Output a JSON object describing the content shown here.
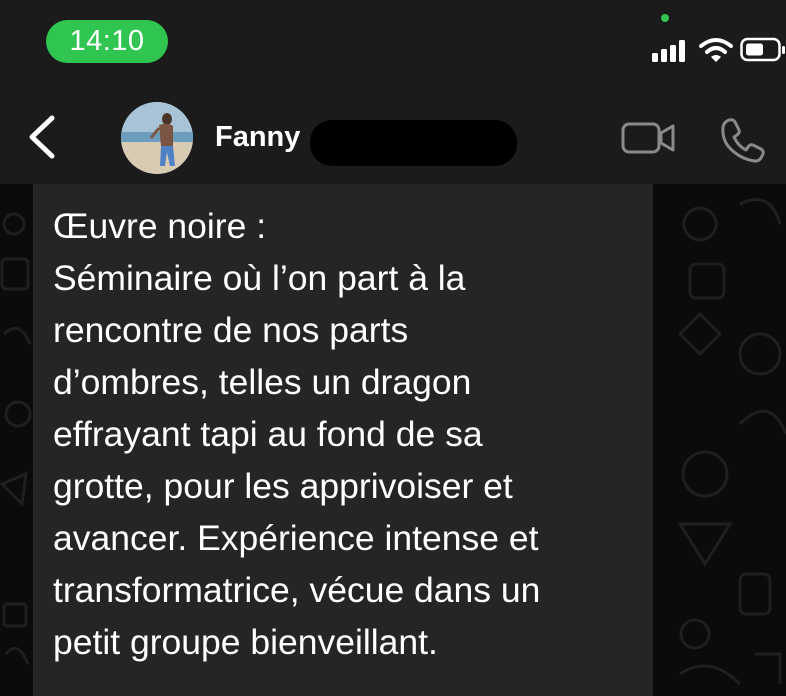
{
  "status_bar": {
    "time": "14:10",
    "icons": [
      "signal-icon",
      "wifi-icon",
      "battery-icon"
    ],
    "accent_color": "#2fc550"
  },
  "header": {
    "contact_name": "Fanny",
    "icons": [
      "back-chevron-icon",
      "video-camera-icon",
      "phone-icon"
    ]
  },
  "message": {
    "text": "Œuvre noire :\nSéminaire où l’on part à la\nrencontre de nos parts\nd’ombres, telles un dragon\neffrayant tapi au fond de sa\ngrotte, pour les apprivoiser et\navancer. Expérience intense et\ntransformatrice, vécue dans un\npetit groupe bienveillant."
  }
}
